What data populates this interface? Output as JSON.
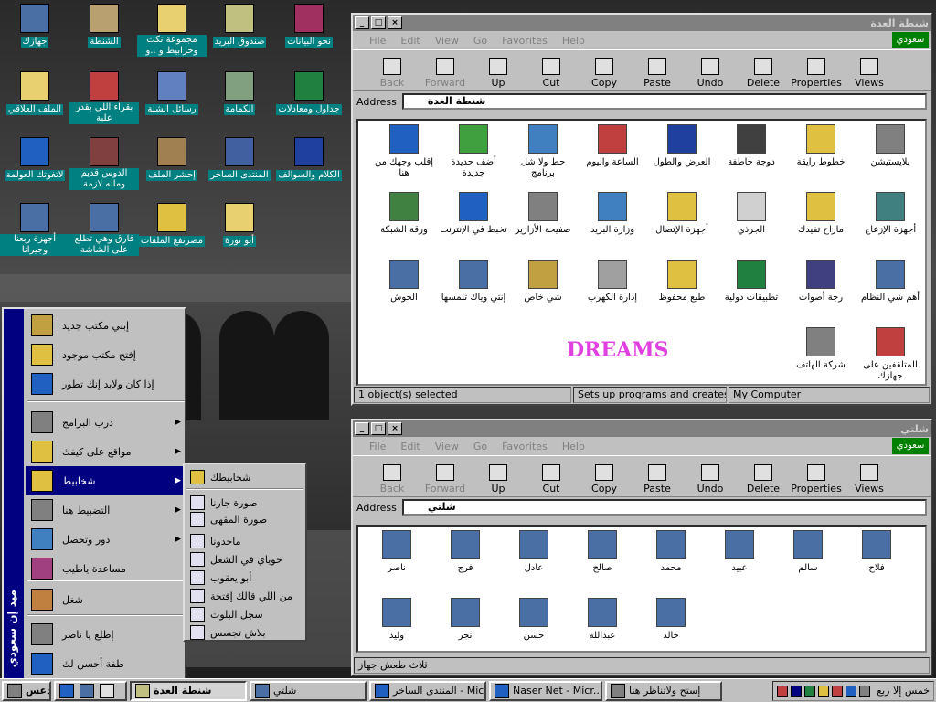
{
  "desktop": {
    "icons": [
      {
        "label": "جهازك",
        "color": "#4a6fa5"
      },
      {
        "label": "الشنطة",
        "color": "#b8a070"
      },
      {
        "label": "مجموعة نكت وخرابيط و ..و",
        "color": "#e8d070"
      },
      {
        "label": "صندوق البريد",
        "color": "#c0c080"
      },
      {
        "label": "نحو البيانات",
        "color": "#a03060"
      },
      {
        "label": "الملف العلاقي",
        "color": "#e8d070"
      },
      {
        "label": "بقراء اللي بقدر علية",
        "color": "#c04040"
      },
      {
        "label": "رسائل الشلة",
        "color": "#6080c0"
      },
      {
        "label": "الكمامة",
        "color": "#80a080"
      },
      {
        "label": "جداول ومعادلات",
        "color": "#208040"
      },
      {
        "label": "لاتغوتك العولمة",
        "color": "#2060c0"
      },
      {
        "label": "الدوس قديم وماله لازمة",
        "color": "#804040"
      },
      {
        "label": "إحشر الملف",
        "color": "#a08050"
      },
      {
        "label": "المنتدى الساخر",
        "color": "#4060a0"
      },
      {
        "label": "الكلام والسوالف",
        "color": "#2040a0"
      },
      {
        "label": "أجهزة ربعنا وجيرانا",
        "color": "#4a6fa5"
      },
      {
        "label": "فارق وهي تطلع على الشاشة",
        "color": "#4a6fa5"
      },
      {
        "label": "مصرتفع الملفات",
        "color": "#e0c040"
      },
      {
        "label": "أبو نورة",
        "color": "#e8d070"
      }
    ]
  },
  "win1": {
    "title": "شنطة العدة",
    "menu": [
      "File",
      "Edit",
      "View",
      "Go",
      "Favorites",
      "Help"
    ],
    "brand": "سعودي",
    "toolbar": [
      "Back",
      "Forward",
      "Up",
      "Cut",
      "Copy",
      "Paste",
      "Undo",
      "Delete",
      "Properties",
      "Views"
    ],
    "address_label": "Address",
    "address": "شنطة العدة",
    "items": [
      {
        "label": "بلايستيشن",
        "color": "#808080"
      },
      {
        "label": "خطوط رايقة",
        "color": "#e0c040"
      },
      {
        "label": "دوجة خاطفة",
        "color": "#404040"
      },
      {
        "label": "العرض والطول",
        "color": "#2040a0"
      },
      {
        "label": "الساعة واليوم",
        "color": "#c04040"
      },
      {
        "label": "حط ولا شل برنامج",
        "color": "#4080c0"
      },
      {
        "label": "أضف حديدة جديدة",
        "color": "#40a040"
      },
      {
        "label": "إقلب وجهك من هنا",
        "color": "#2060c0"
      },
      {
        "label": "أجهزة الإزعاج",
        "color": "#408080"
      },
      {
        "label": "ماراح تفيدك",
        "color": "#e0c040"
      },
      {
        "label": "الجرذي",
        "color": "#d0d0d0"
      },
      {
        "label": "أجهزة الإتصال",
        "color": "#e0c040"
      },
      {
        "label": "وزارة البريد",
        "color": "#4080c0"
      },
      {
        "label": "صفيحة الأزارير",
        "color": "#808080"
      },
      {
        "label": "تخبط في الإنترنت",
        "color": "#2060c0"
      },
      {
        "label": "ورقة الشبكة",
        "color": "#408040"
      },
      {
        "label": "أهم شي النظام",
        "color": "#4a6fa5"
      },
      {
        "label": "رجة أصوات",
        "color": "#404080"
      },
      {
        "label": "تطبيقات دولية",
        "color": "#208040"
      },
      {
        "label": "طبع محفوظ",
        "color": "#e0c040"
      },
      {
        "label": "إدارة الكهرب",
        "color": "#a0a0a0"
      },
      {
        "label": "شي خاص",
        "color": "#c0a040"
      },
      {
        "label": "إنتي وياك تلمسها",
        "color": "#4a6fa5"
      },
      {
        "label": "الحوش",
        "color": "#4a6fa5"
      },
      {
        "label": "المتلقفين على جهازك",
        "color": "#c04040"
      },
      {
        "label": "شركة الهاتف",
        "color": "#808080"
      }
    ],
    "overlay_text": "DREAMS",
    "status": [
      "1 object(s) selected",
      "Sets up programs and creates shor",
      "My Computer"
    ]
  },
  "win2": {
    "title": "شلتي",
    "menu": [
      "File",
      "Edit",
      "View",
      "Go",
      "Favorites",
      "Help"
    ],
    "brand": "سعودي",
    "toolbar": [
      "Back",
      "Forward",
      "Up",
      "Cut",
      "Copy",
      "Paste",
      "Undo",
      "Delete",
      "Properties",
      "Views"
    ],
    "address_label": "Address",
    "address": "شلتي",
    "items": [
      "ناصر",
      "فرج",
      "عادل",
      "صالح",
      "محمد",
      "عبيد",
      "سالم",
      "فلاح",
      "وليد",
      "نجر",
      "حسن",
      "عبدالله",
      "خالد"
    ],
    "status": "ثلاث طعش جهاز"
  },
  "startmenu": {
    "band_text": "ميد إن سعودي",
    "items": [
      {
        "label": "إبني مكتب جديد",
        "arrow": false
      },
      {
        "label": "إفتح مكتب موجود",
        "arrow": false
      },
      {
        "label": "إذا كان ولابد إنك تطور",
        "arrow": false
      },
      {
        "label": "درب البرامج",
        "arrow": true
      },
      {
        "label": "مواقع على كيفك",
        "arrow": true
      },
      {
        "label": "شخابيط",
        "arrow": true
      },
      {
        "label": "التضبيط هنا",
        "arrow": true
      },
      {
        "label": "دور وتحصل",
        "arrow": true
      },
      {
        "label": "مساعدة ياطيب",
        "arrow": false
      },
      {
        "label": "شغل",
        "arrow": false
      },
      {
        "label": "إطلع يا ناصر",
        "arrow": false
      },
      {
        "label": "طفة أحسن لك",
        "arrow": false
      }
    ]
  },
  "submenu": {
    "items": [
      "شخابيطك",
      "صورة جارنا",
      "صورة المقهى",
      "ماجدونا",
      "خوياي في الشغل",
      "أبو يعقوب",
      "من اللي قالك إفتحة",
      "سجل البلوت",
      "بلاش تجسس"
    ]
  },
  "taskbar": {
    "start": "إبدعس",
    "tasks": [
      "شنطة العدة",
      "شلتي",
      "المنتدى الساخر - Mic...",
      "Naser Net - Micr...",
      "إستح ولاتناظر هنا"
    ],
    "clock": "خمس إلا ربع"
  }
}
